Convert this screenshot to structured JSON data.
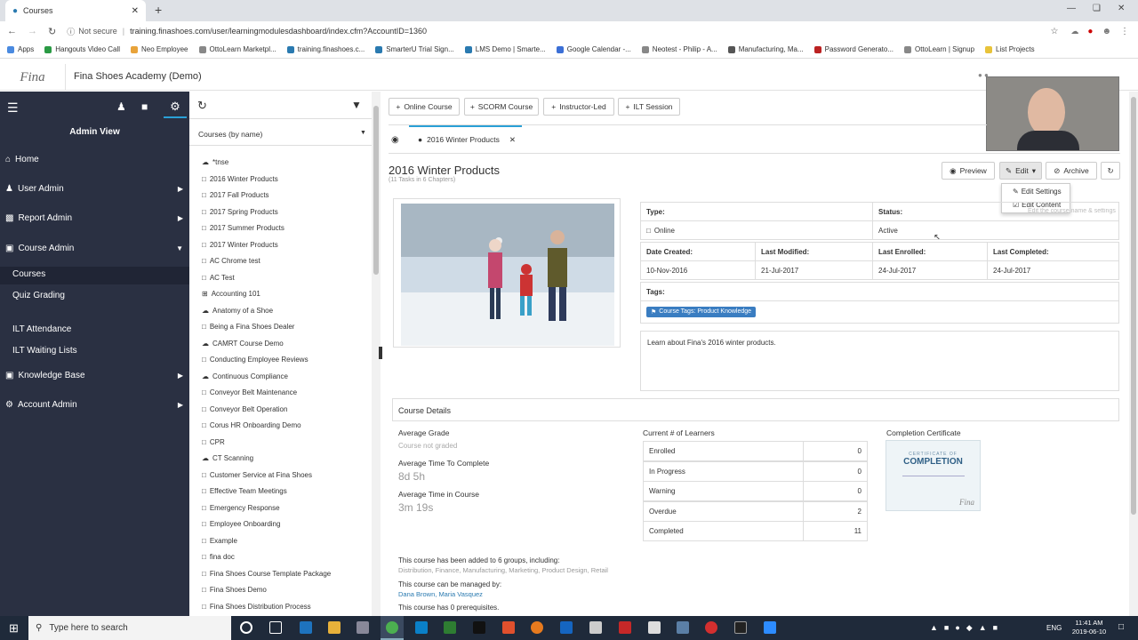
{
  "browser": {
    "tab_title": "Courses",
    "url_prefix": "Not secure",
    "url": "training.finashoes.com/user/learningmodulesdashboard/index.cfm?AccountID=1360",
    "bookmarks": [
      "Apps",
      "Hangouts Video Call",
      "Neo Employee",
      "OttoLearn Marketpl...",
      "training.finashoes.c...",
      "SmarterU Trial Sign...",
      "LMS Demo | Smarte...",
      "Google Calendar -...",
      "Neotest - Philip - A...",
      "Manufacturing, Ma...",
      "Password Generato...",
      "OttoLearn | Signup"
    ],
    "other_bookmarks": "List Projects"
  },
  "app": {
    "logo": "Fina",
    "title": "Fina Shoes Academy (Demo)"
  },
  "nav": {
    "view_label": "Admin View",
    "items": [
      {
        "label": "Home"
      },
      {
        "label": "User Admin"
      },
      {
        "label": "Report Admin"
      },
      {
        "label": "Course Admin"
      }
    ],
    "course_admin_sub": [
      "Courses",
      "Quiz Grading",
      "ILT Attendance",
      "ILT Waiting Lists"
    ],
    "bottom_items": [
      {
        "label": "Knowledge Base"
      },
      {
        "label": "Account Admin"
      }
    ]
  },
  "course_list": {
    "sort_label": "Courses (by name)",
    "items": [
      "*tnse",
      "2016 Winter Products",
      "2017 Fall Products",
      "2017 Spring Products",
      "2017 Summer Products",
      "2017 Winter Products",
      "AC Chrome test",
      "AC Test",
      "Accounting 101",
      "Anatomy of a Shoe",
      "Being a Fina Shoes Dealer",
      "CAMRT Course Demo",
      "Conducting Employee Reviews",
      "Continuous Compliance",
      "Conveyor Belt Maintenance",
      "Conveyor Belt Operation",
      "Corus HR Onboarding Demo",
      "CPR",
      "CT Scanning",
      "Customer Service at Fina Shoes",
      "Effective Team Meetings",
      "Emergency Response",
      "Employee Onboarding",
      "Example",
      "fina doc",
      "Fina Shoes Course Template Package",
      "Fina Shoes Demo",
      "Fina Shoes Distribution Process"
    ]
  },
  "toolbar": {
    "buttons": [
      "Online Course",
      "SCORM Course",
      "Instructor-Led",
      "ILT Session"
    ]
  },
  "tabs": {
    "open_tab": "2016 Winter Products"
  },
  "course": {
    "title": "2016 Winter Products",
    "subtitle": "(11 Tasks in 6 Chapters)",
    "preview_label": "Preview",
    "edit_label": "Edit",
    "archive_label": "Archive",
    "edit_menu": [
      "Edit Settings",
      "Edit Content"
    ],
    "tooltip": "Edit the course name & settings",
    "type_label": "Type:",
    "type_value": "Online",
    "status_label": "Status:",
    "status_value": "Active",
    "date_created_label": "Date Created:",
    "date_created": "10-Nov-2016",
    "last_modified_label": "Last Modified:",
    "last_modified": "21-Jul-2017",
    "last_enrolled_label": "Last Enrolled:",
    "last_enrolled": "24-Jul-2017",
    "last_completed_label": "Last Completed:",
    "last_completed": "24-Jul-2017",
    "tags_label": "Tags:",
    "tag": "Course Tags: Product Knowledge",
    "description": "Learn about Fina's 2016 winter products."
  },
  "details": {
    "heading": "Course Details",
    "avg_grade_label": "Average Grade",
    "avg_grade_value": "Course not graded",
    "avg_time_complete_label": "Average Time To Complete",
    "avg_time_complete": "8d 5h",
    "avg_time_course_label": "Average Time in Course",
    "avg_time_course": "3m 19s",
    "learners_heading": "Current # of Learners",
    "learners": [
      {
        "label": "Enrolled",
        "value": "0"
      },
      {
        "label": "In Progress",
        "value": "0"
      },
      {
        "label": "Warning",
        "value": "0"
      },
      {
        "label": "Overdue",
        "value": "2"
      },
      {
        "label": "Completed",
        "value": "11"
      }
    ],
    "certificate_heading": "Completion Certificate",
    "cert_small": "CERTIFICATE OF",
    "cert_big": "COMPLETION",
    "groups_text": "This course has been added to 6 groups, including:",
    "groups_list": "Distribution, Finance, Manufacturing, Marketing, Product Design, Retail",
    "managers_text": "This course can be managed by:",
    "managers": "Dana Brown, Maria Vasquez",
    "prereq_text": "This course has 0 prerequisites."
  },
  "taskbar": {
    "search_placeholder": "Type here to search",
    "lang": "ENG",
    "time": "11:41 AM",
    "date": "2019-06-10"
  },
  "colors": {
    "nav_bg": "#2a3042",
    "accent": "#2a7ab0",
    "tag_bg": "#3a7dc1"
  }
}
